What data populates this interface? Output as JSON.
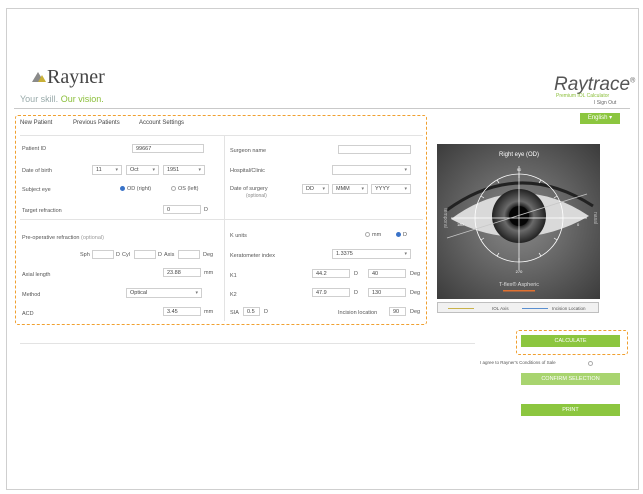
{
  "brand": {
    "name": "Rayner",
    "tagline_a": "Your skill.",
    "tagline_b": "Our vision."
  },
  "product": {
    "name": "Raytrace",
    "trademark": "®",
    "subtitle": "Premium IOL Calculator"
  },
  "signout": "I Sign Out",
  "language": "English ▾",
  "nav": {
    "new_patient": "New Patient",
    "previous_patients": "Previous Patients",
    "account_settings": "Account Settings"
  },
  "form": {
    "patient_id_label": "Patient ID",
    "patient_id_value": "99667",
    "dob_label": "Date of birth",
    "dob_day": "11",
    "dob_month": "Oct",
    "dob_year": "1951",
    "subject_eye_label": "Subject eye",
    "od_label": "OD (right)",
    "os_label": "OS (left)",
    "target_refraction_label": "Target refraction",
    "target_refraction_value": "0",
    "target_refraction_unit": "D",
    "preop_label": "Pre-operative refraction",
    "preop_optional": "(optional)",
    "sph_label": "Sph",
    "d1": "D",
    "cyl_label": "Cyl",
    "d2": "D",
    "axis_label": "Axis",
    "deg_label": "Deg",
    "axial_length_label": "Axial length",
    "axial_length_value": "23.88",
    "axial_length_unit": "mm",
    "method_label": "Method",
    "method_value": "Optical",
    "acd_label": "ACD",
    "acd_value": "3.45",
    "acd_unit": "mm",
    "surgeon_label": "Surgeon name",
    "surgeon_value": "",
    "hospital_label": "Hospital/Clinic",
    "hospital_value": "",
    "surgery_date_label": "Date of surgery",
    "surgery_date_optional": "(optional)",
    "surgery_dd": "DD",
    "surgery_mmm": "MMM",
    "surgery_yyyy": "YYYY",
    "k_units_label": "K units",
    "k_mm": "mm",
    "k_d": "D",
    "keratometer_label": "Keratometer index",
    "keratometer_value": "1.3375",
    "k1_label": "K1",
    "k1_value": "44.2",
    "k1_unit": "D",
    "k1_axis": "40",
    "k1_deg": "Deg",
    "k2_label": "K2",
    "k2_value": "47.9",
    "k2_unit": "D",
    "k2_axis": "130",
    "k2_deg": "Deg",
    "sia_label": "SIA",
    "sia_value": "0.5",
    "sia_unit": "D",
    "incision_label": "Incision location",
    "incision_value": "90",
    "incision_unit": "Deg"
  },
  "eye_panel": {
    "title": "Right eye (OD)",
    "temporal": "temporal",
    "nasal": "nasal",
    "lens": "T-flex® Aspheric",
    "deg_90": "90",
    "deg_180": "180",
    "deg_270": "270",
    "deg_0": "0"
  },
  "legend": {
    "iol_axis": "IOL Axis",
    "incision_location": "Incision Location"
  },
  "actions": {
    "calculate": "CALCULATE",
    "agree": "I agree to Rayner's Conditions of Sale",
    "confirm": "CONFIRM SELECTION",
    "print": "PRINT"
  },
  "colors": {
    "accent_green": "#8cc63f",
    "highlight_orange": "#f0a030",
    "radio_blue": "#3a73c8"
  }
}
